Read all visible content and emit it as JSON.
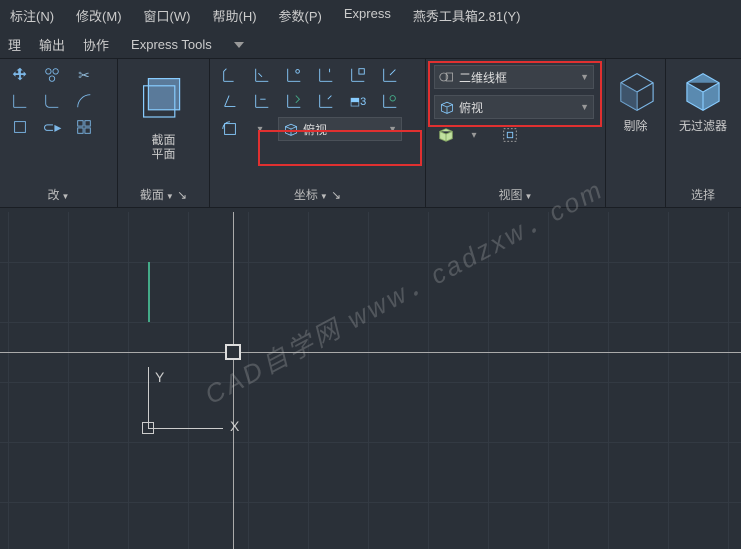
{
  "menu": {
    "biaozhu": "标注(N)",
    "xiugai": "修改(M)",
    "chuangkou": "窗口(W)",
    "bangzhu": "帮助(H)",
    "canshu": "参数(P)",
    "express": "Express",
    "yanxiu": "燕秀工具箱2.81(Y)"
  },
  "tabs": {
    "li": "理",
    "shuchu": "输出",
    "xiezuo": "协作",
    "express_tools": "Express Tools"
  },
  "panels": {
    "gai": "改",
    "jiemian": "截面",
    "zuobiao": "坐标",
    "shitu": "视图",
    "xuanze": "选择"
  },
  "section": {
    "label1": "截面",
    "label2": "平面"
  },
  "combos": {
    "fushi1": "俯视",
    "erwei": "二维线框",
    "fushi2": "俯视"
  },
  "bigbtn": {
    "tichu": "剔除",
    "wuguolv": "无过滤器"
  },
  "axis": {
    "x": "X",
    "y": "Y"
  },
  "watermark": "CAD自学网  www．cadzxw．com"
}
